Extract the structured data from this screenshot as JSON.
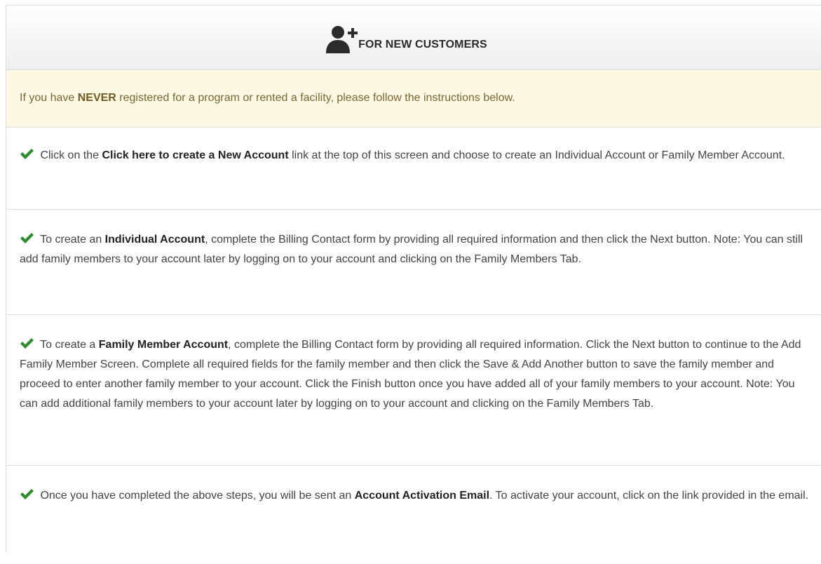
{
  "header": {
    "title": "FOR NEW CUSTOMERS",
    "icon": "user-plus-icon"
  },
  "notice": {
    "pre": "If you have ",
    "bold": "NEVER",
    "post": " registered for a program or rented a facility, please follow the instructions below."
  },
  "steps": [
    {
      "pre": " Click on the ",
      "bold": "Click here to create a New Account",
      "post": " link at the top of this screen and choose to create an Individual Account or Family Member Account."
    },
    {
      "pre": " To create an ",
      "bold": "Individual Account",
      "post": ", complete the Billing Contact form by providing all required information and then click the Next button. Note: You can still add family members to your account later by logging on to your account and clicking on the Family Members Tab."
    },
    {
      "pre": " To create a ",
      "bold": "Family Member Account",
      "post": ", complete the Billing Contact form by providing all required information. Click the Next button to continue to the Add Family Member Screen. Complete all required fields for the family member and then click the Save & Add Another button to save the family member and proceed to enter another family member to your account. Click the Finish button once you have added all of your family members to your account. Note: You can add additional family members to your account later by logging on to your account and clicking on the Family Members Tab."
    },
    {
      "pre": " Once you have completed the above steps, you will be sent an ",
      "bold": "Account Activation Email",
      "post": ". To activate your account, click on the link provided in the email."
    }
  ],
  "colors": {
    "check": "#2e8b2e",
    "notice_bg": "#fcf8e3",
    "border": "#dddddd"
  }
}
